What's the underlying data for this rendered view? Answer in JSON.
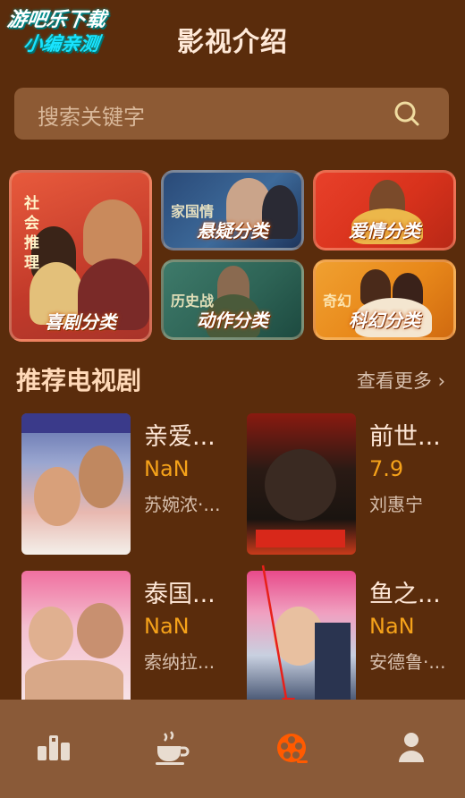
{
  "watermark": {
    "line1": "游吧乐下载",
    "line2": "小编亲测"
  },
  "header": {
    "title": "影视介绍"
  },
  "search": {
    "placeholder": "搜索关键字"
  },
  "categories": [
    {
      "label": "喜剧分类",
      "tag": "社会推理"
    },
    {
      "label": "悬疑分类",
      "tag": "家国情"
    },
    {
      "label": "爱情分类",
      "tag": ""
    },
    {
      "label": "动作分类",
      "tag": "历史战"
    },
    {
      "label": "科幻分类",
      "tag": "奇幻"
    }
  ],
  "recommend": {
    "title": "推荐电视剧",
    "more": "查看更多",
    "items": [
      {
        "name": "亲爱...",
        "score": "NaN",
        "actor": "苏婉浓·..."
      },
      {
        "name": "前世...",
        "score": "7.9",
        "actor": "刘惠宁"
      },
      {
        "name": "泰国...",
        "score": "NaN",
        "actor": "索纳拉..."
      },
      {
        "name": "鱼之...",
        "score": "NaN",
        "actor": "安德鲁·..."
      }
    ]
  },
  "tabbar": {
    "icons": [
      "ranking-icon",
      "coffee-icon",
      "film-reel-icon",
      "user-icon"
    ],
    "active_color": "#ff5a00"
  }
}
